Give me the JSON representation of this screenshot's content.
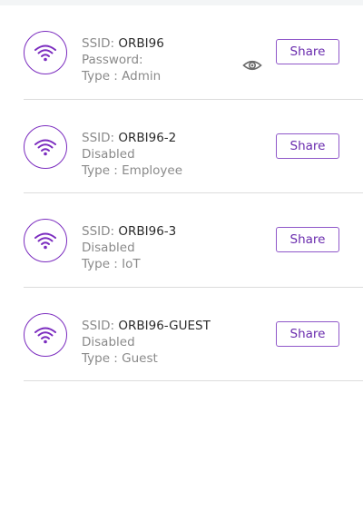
{
  "networks": [
    {
      "ssid_label": "SSID:",
      "ssid": "ORBI96",
      "status": "Password:",
      "type": "Type : Admin",
      "share_label": "Share",
      "show_eye": true
    },
    {
      "ssid_label": "SSID:",
      "ssid": "ORBI96-2",
      "status": "Disabled",
      "type": "Type : Employee",
      "share_label": "Share",
      "show_eye": false
    },
    {
      "ssid_label": "SSID:",
      "ssid": "ORBI96-3",
      "status": "Disabled",
      "type": "Type : IoT",
      "share_label": "Share",
      "show_eye": false
    },
    {
      "ssid_label": "SSID:",
      "ssid": "ORBI96-GUEST",
      "status": "Disabled",
      "type": "Type : Guest",
      "share_label": "Share",
      "show_eye": false
    }
  ],
  "icons": {
    "wifi": "wifi-icon",
    "eye": "eye-icon"
  },
  "colors": {
    "accent": "#7b2cbf",
    "button_text": "#6a2cae",
    "secondary_text": "#8a8a8a",
    "primary_text": "#2b2b2b",
    "divider": "#dcdcdc"
  }
}
